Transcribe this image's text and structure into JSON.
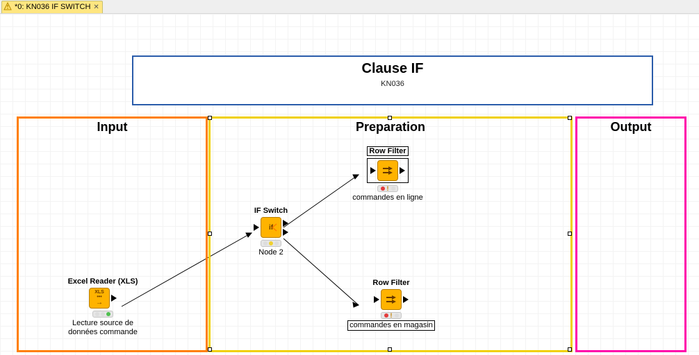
{
  "tab": {
    "label": "*0: KN036 IF SWITCH"
  },
  "title_box": {
    "title": "Clause IF",
    "subtitle": "KN036"
  },
  "groups": {
    "input": {
      "label": "Input"
    },
    "prep": {
      "label": "Preparation"
    },
    "output": {
      "label": "Output"
    }
  },
  "nodes": {
    "excel": {
      "title": "Excel Reader (XLS)",
      "caption": "Lecture source de\ndonnées commande",
      "icon_text": "XLS"
    },
    "ifswitch": {
      "title": "IF Switch",
      "caption": "Node 2",
      "icon_text": "if"
    },
    "rf1": {
      "title": "Row Filter",
      "caption": "commandes en ligne"
    },
    "rf2": {
      "title": "Row Filter",
      "caption": "commandes en magasin"
    }
  }
}
